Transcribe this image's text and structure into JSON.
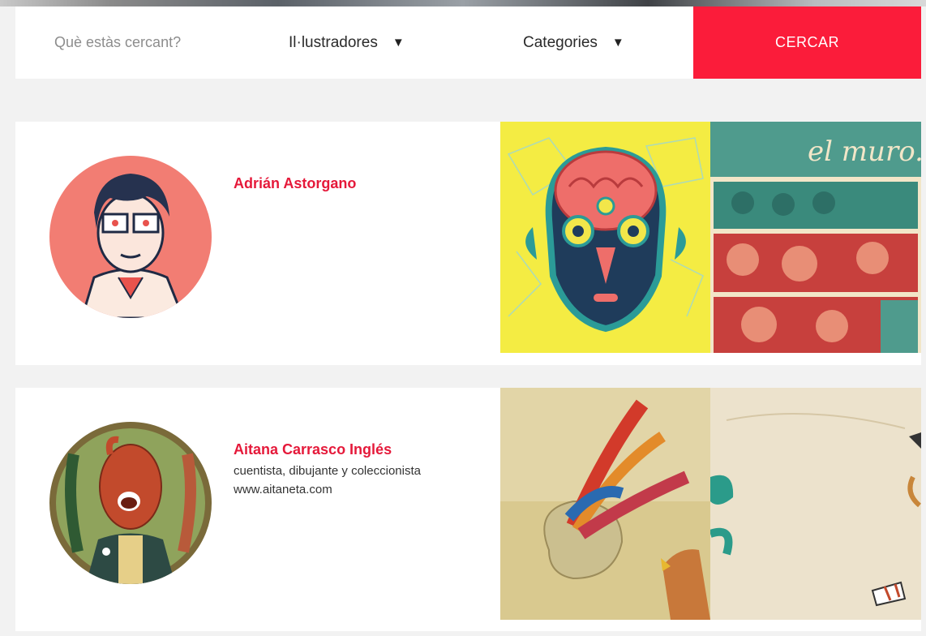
{
  "search": {
    "placeholder": "Què estàs cercant?",
    "illustrators_label": "Il·lustradores",
    "categories_label": "Categories",
    "submit_label": "CERCAR"
  },
  "colors": {
    "accent": "#fb1c3a",
    "name_text": "#e5193a",
    "background": "#f2f2f2"
  },
  "illustrators": [
    {
      "name": "Adrián Astorgano",
      "description": "",
      "website": ""
    },
    {
      "name": "Aitana Carrasco Inglés",
      "description": "cuentista, dibujante y coleccionista",
      "website": "www.aitaneta.com"
    }
  ]
}
